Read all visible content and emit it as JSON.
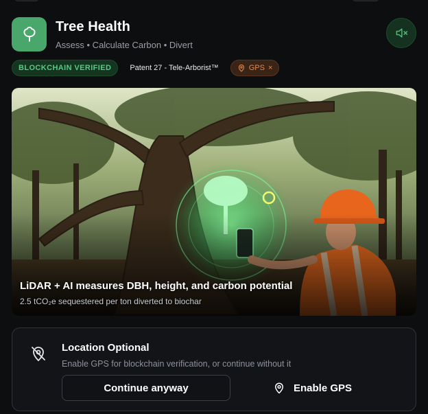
{
  "header": {
    "title": "Tree Health",
    "subtitle": "Assess • Calculate Carbon • Divert",
    "icon": "tree-icon",
    "mute_icon": "speaker-muted-icon"
  },
  "badges": {
    "verified": "BLOCKCHAIN VERIFIED",
    "patent": "Patent 27 - Tele-Arborist™",
    "gps": "GPS",
    "gps_icon": "location-pin-icon",
    "gps_close": "×"
  },
  "hero": {
    "caption": "LiDAR + AI measures DBH, height, and carbon potential",
    "sub": "2.5 tCO₂e sequestered per ton diverted to biochar"
  },
  "location": {
    "title": "Location Optional",
    "description": "Enable GPS for blockchain verification, or continue without it",
    "continue_label": "Continue anyway",
    "enable_label": "Enable GPS",
    "icon": "location-off-icon"
  },
  "colors": {
    "accent_green": "#49a76b",
    "verified_text": "#57c982",
    "gps_orange": "#e48a4e",
    "background": "#0d0e10"
  }
}
